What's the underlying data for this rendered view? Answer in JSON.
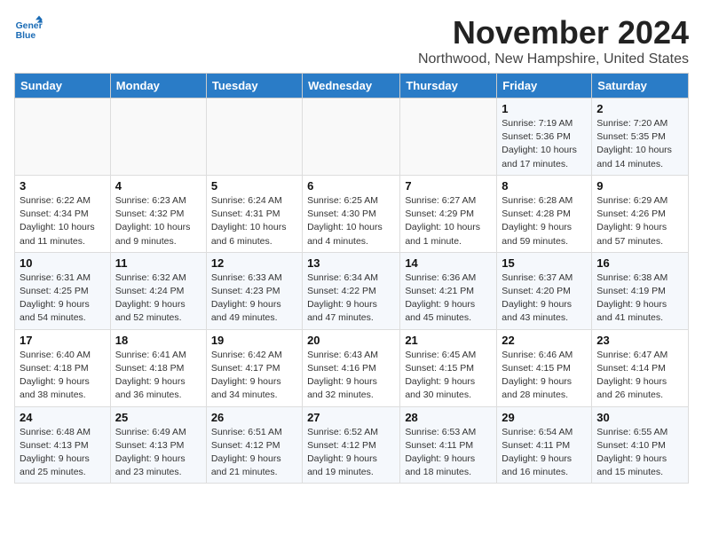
{
  "logo": {
    "line1": "General",
    "line2": "Blue"
  },
  "title": "November 2024",
  "location": "Northwood, New Hampshire, United States",
  "weekdays": [
    "Sunday",
    "Monday",
    "Tuesday",
    "Wednesday",
    "Thursday",
    "Friday",
    "Saturday"
  ],
  "weeks": [
    [
      {
        "day": "",
        "detail": ""
      },
      {
        "day": "",
        "detail": ""
      },
      {
        "day": "",
        "detail": ""
      },
      {
        "day": "",
        "detail": ""
      },
      {
        "day": "",
        "detail": ""
      },
      {
        "day": "1",
        "detail": "Sunrise: 7:19 AM\nSunset: 5:36 PM\nDaylight: 10 hours\nand 17 minutes."
      },
      {
        "day": "2",
        "detail": "Sunrise: 7:20 AM\nSunset: 5:35 PM\nDaylight: 10 hours\nand 14 minutes."
      }
    ],
    [
      {
        "day": "3",
        "detail": "Sunrise: 6:22 AM\nSunset: 4:34 PM\nDaylight: 10 hours\nand 11 minutes."
      },
      {
        "day": "4",
        "detail": "Sunrise: 6:23 AM\nSunset: 4:32 PM\nDaylight: 10 hours\nand 9 minutes."
      },
      {
        "day": "5",
        "detail": "Sunrise: 6:24 AM\nSunset: 4:31 PM\nDaylight: 10 hours\nand 6 minutes."
      },
      {
        "day": "6",
        "detail": "Sunrise: 6:25 AM\nSunset: 4:30 PM\nDaylight: 10 hours\nand 4 minutes."
      },
      {
        "day": "7",
        "detail": "Sunrise: 6:27 AM\nSunset: 4:29 PM\nDaylight: 10 hours\nand 1 minute."
      },
      {
        "day": "8",
        "detail": "Sunrise: 6:28 AM\nSunset: 4:28 PM\nDaylight: 9 hours\nand 59 minutes."
      },
      {
        "day": "9",
        "detail": "Sunrise: 6:29 AM\nSunset: 4:26 PM\nDaylight: 9 hours\nand 57 minutes."
      }
    ],
    [
      {
        "day": "10",
        "detail": "Sunrise: 6:31 AM\nSunset: 4:25 PM\nDaylight: 9 hours\nand 54 minutes."
      },
      {
        "day": "11",
        "detail": "Sunrise: 6:32 AM\nSunset: 4:24 PM\nDaylight: 9 hours\nand 52 minutes."
      },
      {
        "day": "12",
        "detail": "Sunrise: 6:33 AM\nSunset: 4:23 PM\nDaylight: 9 hours\nand 49 minutes."
      },
      {
        "day": "13",
        "detail": "Sunrise: 6:34 AM\nSunset: 4:22 PM\nDaylight: 9 hours\nand 47 minutes."
      },
      {
        "day": "14",
        "detail": "Sunrise: 6:36 AM\nSunset: 4:21 PM\nDaylight: 9 hours\nand 45 minutes."
      },
      {
        "day": "15",
        "detail": "Sunrise: 6:37 AM\nSunset: 4:20 PM\nDaylight: 9 hours\nand 43 minutes."
      },
      {
        "day": "16",
        "detail": "Sunrise: 6:38 AM\nSunset: 4:19 PM\nDaylight: 9 hours\nand 41 minutes."
      }
    ],
    [
      {
        "day": "17",
        "detail": "Sunrise: 6:40 AM\nSunset: 4:18 PM\nDaylight: 9 hours\nand 38 minutes."
      },
      {
        "day": "18",
        "detail": "Sunrise: 6:41 AM\nSunset: 4:18 PM\nDaylight: 9 hours\nand 36 minutes."
      },
      {
        "day": "19",
        "detail": "Sunrise: 6:42 AM\nSunset: 4:17 PM\nDaylight: 9 hours\nand 34 minutes."
      },
      {
        "day": "20",
        "detail": "Sunrise: 6:43 AM\nSunset: 4:16 PM\nDaylight: 9 hours\nand 32 minutes."
      },
      {
        "day": "21",
        "detail": "Sunrise: 6:45 AM\nSunset: 4:15 PM\nDaylight: 9 hours\nand 30 minutes."
      },
      {
        "day": "22",
        "detail": "Sunrise: 6:46 AM\nSunset: 4:15 PM\nDaylight: 9 hours\nand 28 minutes."
      },
      {
        "day": "23",
        "detail": "Sunrise: 6:47 AM\nSunset: 4:14 PM\nDaylight: 9 hours\nand 26 minutes."
      }
    ],
    [
      {
        "day": "24",
        "detail": "Sunrise: 6:48 AM\nSunset: 4:13 PM\nDaylight: 9 hours\nand 25 minutes."
      },
      {
        "day": "25",
        "detail": "Sunrise: 6:49 AM\nSunset: 4:13 PM\nDaylight: 9 hours\nand 23 minutes."
      },
      {
        "day": "26",
        "detail": "Sunrise: 6:51 AM\nSunset: 4:12 PM\nDaylight: 9 hours\nand 21 minutes."
      },
      {
        "day": "27",
        "detail": "Sunrise: 6:52 AM\nSunset: 4:12 PM\nDaylight: 9 hours\nand 19 minutes."
      },
      {
        "day": "28",
        "detail": "Sunrise: 6:53 AM\nSunset: 4:11 PM\nDaylight: 9 hours\nand 18 minutes."
      },
      {
        "day": "29",
        "detail": "Sunrise: 6:54 AM\nSunset: 4:11 PM\nDaylight: 9 hours\nand 16 minutes."
      },
      {
        "day": "30",
        "detail": "Sunrise: 6:55 AM\nSunset: 4:10 PM\nDaylight: 9 hours\nand 15 minutes."
      }
    ]
  ]
}
